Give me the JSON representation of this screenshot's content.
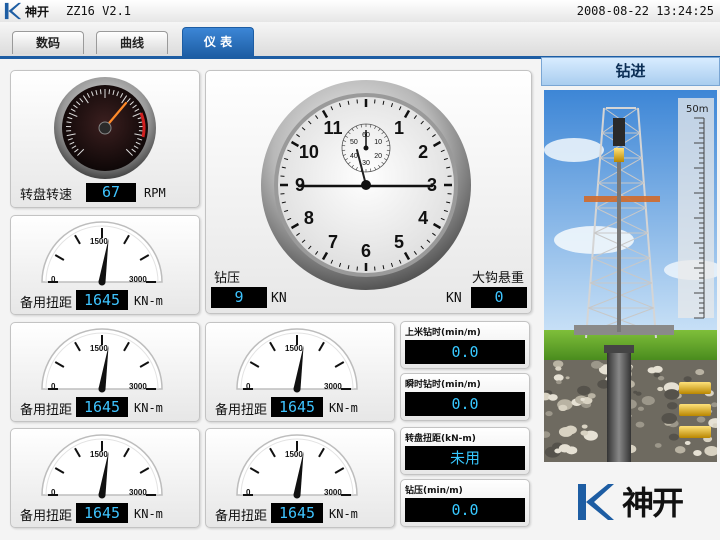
{
  "app": {
    "brand": "神开",
    "title": "ZZ16 V2.1",
    "datetime": "2008-08-22 13:24:25"
  },
  "tabs": [
    {
      "label": "数码"
    },
    {
      "label": "曲线"
    },
    {
      "label": "仪 表",
      "active": true
    }
  ],
  "rotary": {
    "label": "转盘转速",
    "value": "67",
    "unit": "RPM"
  },
  "center": {
    "clock_numbers": [
      "1",
      "2",
      "3",
      "4",
      "5",
      "6",
      "7",
      "8",
      "9",
      "10",
      "11"
    ],
    "sub_numbers": [
      "10",
      "20",
      "30",
      "40",
      "50",
      "60"
    ],
    "wob": {
      "label": "钻压",
      "value": "9",
      "unit": "KN"
    },
    "hook": {
      "label": "大钩悬重",
      "value": "0",
      "unit": "KN"
    }
  },
  "torque_gauges": [
    {
      "min": "0",
      "mid": "1500",
      "max": "3000",
      "label": "备用扭距",
      "value": "1645",
      "unit": "KN-m",
      "fraction": 0.548
    },
    {
      "min": "0",
      "mid": "1500",
      "max": "3000",
      "label": "备用扭距",
      "value": "1645",
      "unit": "KN-m",
      "fraction": 0.548
    },
    {
      "min": "0",
      "mid": "1500",
      "max": "3000",
      "label": "备用扭距",
      "value": "1645",
      "unit": "KN-m",
      "fraction": 0.548
    },
    {
      "min": "0",
      "mid": "1500",
      "max": "3000",
      "label": "备用扭距",
      "value": "1645",
      "unit": "KN-m",
      "fraction": 0.548
    },
    {
      "min": "0",
      "mid": "1500",
      "max": "3000",
      "label": "备用扭距",
      "value": "1645",
      "unit": "KN-m",
      "fraction": 0.548
    }
  ],
  "readouts": [
    {
      "label": "上米钻时(min/m)",
      "value": "0.0"
    },
    {
      "label": "瞬时钻时(min/m)",
      "value": "0.0"
    },
    {
      "label": "转盘扭距(kN-m)",
      "value": "未用"
    },
    {
      "label": "钻压(min/m)",
      "value": "0.0"
    }
  ],
  "rig": {
    "title": "钻进",
    "scale_label": "50m",
    "brand": "神开"
  },
  "colors": {
    "accent": "#1d5da3",
    "lcd_text": "#3ec4ff",
    "lcd_bg": "#000000"
  }
}
